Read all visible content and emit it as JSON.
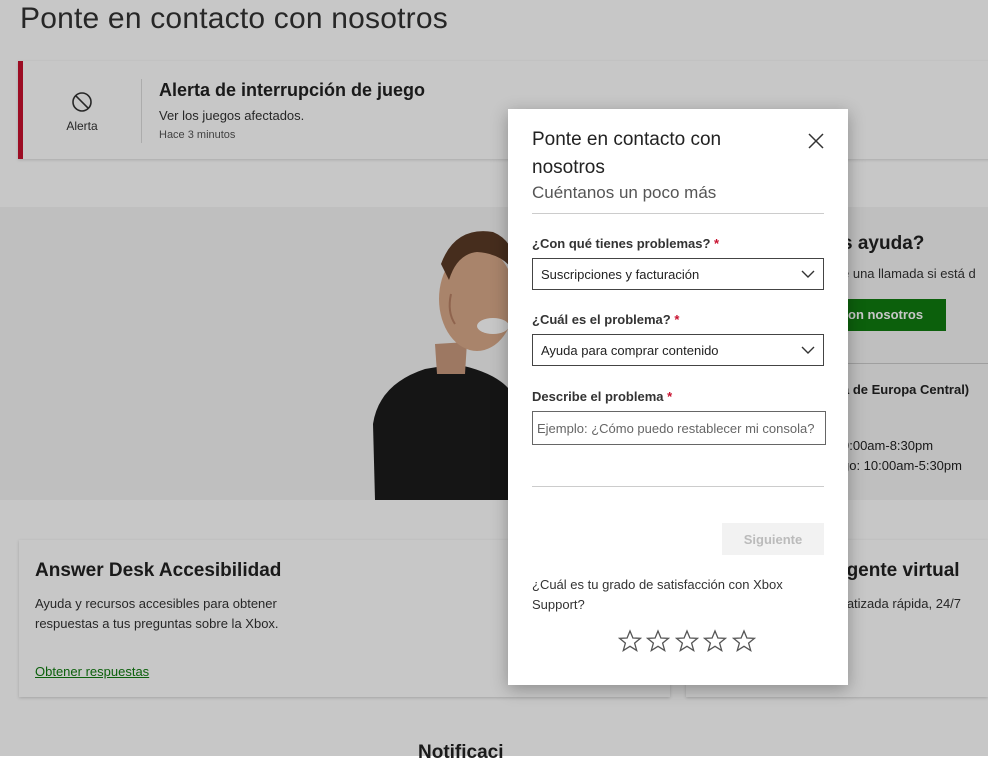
{
  "page": {
    "title": "Ponte en contacto con nosotros"
  },
  "alert": {
    "icon": "prohibited-icon",
    "icon_label": "Alerta",
    "title": "Alerta de interrupción de juego",
    "description": "Ver los juegos afectados.",
    "time": "Hace 3 minutos",
    "accent_color": "#c8102e"
  },
  "hero": {
    "title_partial": "s ayuda?",
    "description_partial": "e una llamada si está d",
    "button_partial": "on nosotros",
    "button_color": "#107c10",
    "timezone_partial": "a de Europa Central)",
    "hours_line1_partial": "9:00am-8:30pm",
    "hours_line2_partial": "go: 10:00am-5:30pm"
  },
  "cards": {
    "left": {
      "title": "Answer Desk Accesibilidad",
      "description": "Ayuda y recursos accesibles para obtener respuestas a tus preguntas sobre la Xbox.",
      "link": "Obtener respuestas"
    },
    "right": {
      "title_partial": "agente virtual",
      "description_partial": "matizada rápida, 24/7"
    }
  },
  "bottom_heading_partial": "Notificaci",
  "modal": {
    "title": "Ponte en contacto con nosotros",
    "subtitle": "Cuéntanos un poco más",
    "close_icon": "close-icon",
    "required_marker": "*",
    "field1": {
      "label": "¿Con qué tienes problemas?",
      "value": "Suscripciones y facturación"
    },
    "field2": {
      "label": "¿Cuál es el problema?",
      "value": "Ayuda para comprar contenido"
    },
    "field3": {
      "label": "Describe el problema",
      "placeholder": "Ejemplo: ¿Cómo puedo restablecer mi consola?"
    },
    "next_button": "Siguiente",
    "satisfaction_question": "¿Cuál es tu grado de satisfacción con Xbox Support?",
    "rating": {
      "max": 5,
      "value": 0
    }
  }
}
